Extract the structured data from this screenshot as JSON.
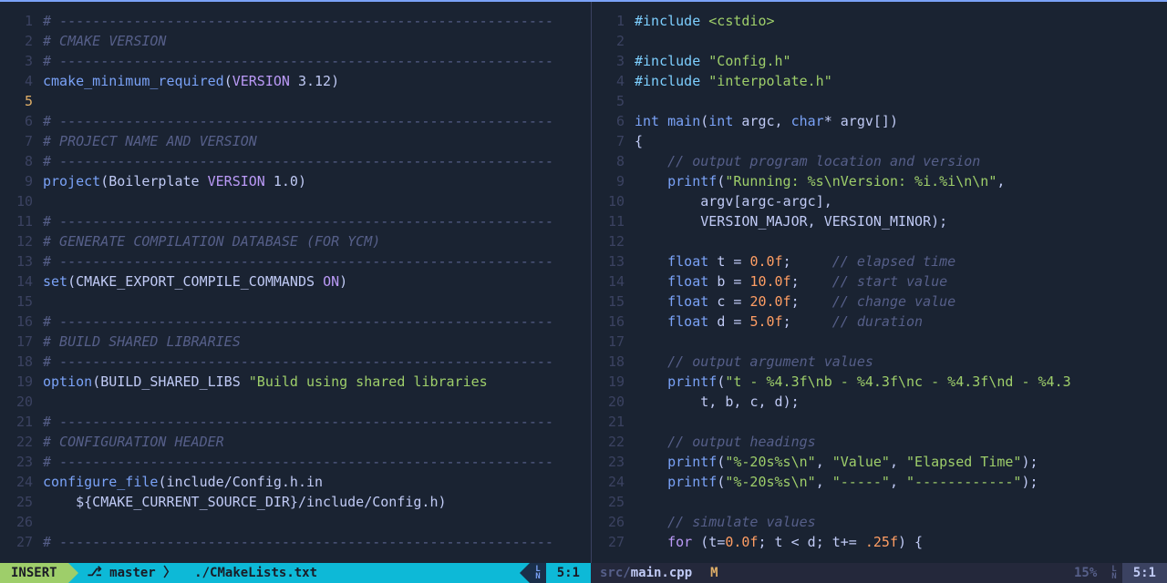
{
  "left": {
    "lines": [
      {
        "n": 1,
        "t": "comment-sep",
        "text": "# ------------------------------------------------------------"
      },
      {
        "n": 2,
        "t": "comment",
        "text": "# CMAKE VERSION"
      },
      {
        "n": 3,
        "t": "comment-sep",
        "text": "# ------------------------------------------------------------"
      },
      {
        "n": 4,
        "t": "cmake",
        "tokens": [
          [
            "func",
            "cmake_minimum_required"
          ],
          [
            "paren",
            "("
          ],
          [
            "keyword",
            "VERSION"
          ],
          [
            "id",
            " 3.12"
          ],
          [
            "paren",
            ")"
          ]
        ]
      },
      {
        "n": 5,
        "t": "blank",
        "current": true
      },
      {
        "n": 6,
        "t": "comment-sep",
        "text": "# ------------------------------------------------------------"
      },
      {
        "n": 7,
        "t": "comment",
        "text": "# PROJECT NAME AND VERSION"
      },
      {
        "n": 8,
        "t": "comment-sep",
        "text": "# ------------------------------------------------------------"
      },
      {
        "n": 9,
        "t": "cmake",
        "tokens": [
          [
            "func",
            "project"
          ],
          [
            "paren",
            "("
          ],
          [
            "id",
            "Boilerplate "
          ],
          [
            "keyword",
            "VERSION"
          ],
          [
            "id",
            " 1.0"
          ],
          [
            "paren",
            ")"
          ]
        ]
      },
      {
        "n": 10,
        "t": "blank"
      },
      {
        "n": 11,
        "t": "comment-sep",
        "text": "# ------------------------------------------------------------"
      },
      {
        "n": 12,
        "t": "comment",
        "text": "# GENERATE COMPILATION DATABASE (FOR YCM)"
      },
      {
        "n": 13,
        "t": "comment-sep",
        "text": "# ------------------------------------------------------------"
      },
      {
        "n": 14,
        "t": "cmake",
        "tokens": [
          [
            "func",
            "set"
          ],
          [
            "paren",
            "("
          ],
          [
            "id",
            "CMAKE_EXPORT_COMPILE_COMMANDS "
          ],
          [
            "keyword",
            "ON"
          ],
          [
            "paren",
            ")"
          ]
        ]
      },
      {
        "n": 15,
        "t": "blank"
      },
      {
        "n": 16,
        "t": "comment-sep",
        "text": "# ------------------------------------------------------------"
      },
      {
        "n": 17,
        "t": "comment",
        "text": "# BUILD SHARED LIBRARIES"
      },
      {
        "n": 18,
        "t": "comment-sep",
        "text": "# ------------------------------------------------------------"
      },
      {
        "n": 19,
        "t": "cmake",
        "tokens": [
          [
            "func",
            "option"
          ],
          [
            "paren",
            "("
          ],
          [
            "id",
            "BUILD_SHARED_LIBS "
          ],
          [
            "string",
            "\"Build using shared libraries"
          ]
        ]
      },
      {
        "n": 20,
        "t": "blank"
      },
      {
        "n": 21,
        "t": "comment-sep",
        "text": "# ------------------------------------------------------------"
      },
      {
        "n": 22,
        "t": "comment",
        "text": "# CONFIGURATION HEADER"
      },
      {
        "n": 23,
        "t": "comment-sep",
        "text": "# ------------------------------------------------------------"
      },
      {
        "n": 24,
        "t": "cmake",
        "tokens": [
          [
            "func",
            "configure_file"
          ],
          [
            "paren",
            "("
          ],
          [
            "id",
            "include/Config.h.in"
          ]
        ]
      },
      {
        "n": 25,
        "t": "cmake",
        "tokens": [
          [
            "id",
            "    ${CMAKE_CURRENT_SOURCE_DIR}/include/Config.h"
          ],
          [
            "paren",
            ")"
          ]
        ]
      },
      {
        "n": 26,
        "t": "blank"
      },
      {
        "n": 27,
        "t": "comment-sep",
        "text": "# ------------------------------------------------------------"
      }
    ]
  },
  "right": {
    "lines": [
      {
        "n": 1,
        "tokens": [
          [
            "include",
            "#include "
          ],
          [
            "incl-path",
            "<cstdio>"
          ]
        ]
      },
      {
        "n": 2,
        "tokens": []
      },
      {
        "n": 3,
        "tokens": [
          [
            "include",
            "#include "
          ],
          [
            "incl-path",
            "\"Config.h\""
          ]
        ]
      },
      {
        "n": 4,
        "tokens": [
          [
            "include",
            "#include "
          ],
          [
            "incl-path",
            "\"interpolate.h\""
          ]
        ]
      },
      {
        "n": 5,
        "tokens": []
      },
      {
        "n": 6,
        "tokens": [
          [
            "type",
            "int "
          ],
          [
            "func",
            "main"
          ],
          [
            "paren",
            "("
          ],
          [
            "type",
            "int "
          ],
          [
            "id",
            "argc"
          ],
          [
            "punct",
            ", "
          ],
          [
            "type",
            "char"
          ],
          [
            "punct",
            "* "
          ],
          [
            "id",
            "argv"
          ],
          [
            "paren",
            "[])"
          ]
        ]
      },
      {
        "n": 7,
        "tokens": [
          [
            "paren",
            "{"
          ]
        ]
      },
      {
        "n": 8,
        "tokens": [
          [
            "id",
            "    "
          ],
          [
            "comment",
            "// output program location and version"
          ]
        ]
      },
      {
        "n": 9,
        "tokens": [
          [
            "id",
            "    "
          ],
          [
            "func",
            "printf"
          ],
          [
            "paren",
            "("
          ],
          [
            "string",
            "\"Running: %s\\nVersion: %i.%i\\n\\n\""
          ],
          [
            "punct",
            ","
          ]
        ]
      },
      {
        "n": 10,
        "tokens": [
          [
            "id",
            "        argv"
          ],
          [
            "paren",
            "["
          ],
          [
            "id",
            "argc"
          ],
          [
            "punct",
            "-"
          ],
          [
            "id",
            "argc"
          ],
          [
            "paren",
            "]"
          ],
          [
            "punct",
            ","
          ]
        ]
      },
      {
        "n": 11,
        "tokens": [
          [
            "id",
            "        VERSION_MAJOR"
          ],
          [
            "punct",
            ", "
          ],
          [
            "id",
            "VERSION_MINOR"
          ],
          [
            "paren",
            ")"
          ],
          [
            "punct",
            ";"
          ]
        ]
      },
      {
        "n": 12,
        "tokens": []
      },
      {
        "n": 13,
        "tokens": [
          [
            "id",
            "    "
          ],
          [
            "type",
            "float "
          ],
          [
            "id",
            "t "
          ],
          [
            "punct",
            "= "
          ],
          [
            "number",
            "0.0f"
          ],
          [
            "punct",
            ";     "
          ],
          [
            "comment",
            "// elapsed time"
          ]
        ]
      },
      {
        "n": 14,
        "tokens": [
          [
            "id",
            "    "
          ],
          [
            "type",
            "float "
          ],
          [
            "id",
            "b "
          ],
          [
            "punct",
            "= "
          ],
          [
            "number",
            "10.0f"
          ],
          [
            "punct",
            ";    "
          ],
          [
            "comment",
            "// start value"
          ]
        ]
      },
      {
        "n": 15,
        "tokens": [
          [
            "id",
            "    "
          ],
          [
            "type",
            "float "
          ],
          [
            "id",
            "c "
          ],
          [
            "punct",
            "= "
          ],
          [
            "number",
            "20.0f"
          ],
          [
            "punct",
            ";    "
          ],
          [
            "comment",
            "// change value"
          ]
        ]
      },
      {
        "n": 16,
        "tokens": [
          [
            "id",
            "    "
          ],
          [
            "type",
            "float "
          ],
          [
            "id",
            "d "
          ],
          [
            "punct",
            "= "
          ],
          [
            "number",
            "5.0f"
          ],
          [
            "punct",
            ";     "
          ],
          [
            "comment",
            "// duration"
          ]
        ]
      },
      {
        "n": 17,
        "tokens": []
      },
      {
        "n": 18,
        "tokens": [
          [
            "id",
            "    "
          ],
          [
            "comment",
            "// output argument values"
          ]
        ]
      },
      {
        "n": 19,
        "tokens": [
          [
            "id",
            "    "
          ],
          [
            "func",
            "printf"
          ],
          [
            "paren",
            "("
          ],
          [
            "string",
            "\"t - %4.3f\\nb - %4.3f\\nc - %4.3f\\nd - %4.3"
          ]
        ]
      },
      {
        "n": 20,
        "tokens": [
          [
            "id",
            "        t"
          ],
          [
            "punct",
            ", "
          ],
          [
            "id",
            "b"
          ],
          [
            "punct",
            ", "
          ],
          [
            "id",
            "c"
          ],
          [
            "punct",
            ", "
          ],
          [
            "id",
            "d"
          ],
          [
            "paren",
            ")"
          ],
          [
            "punct",
            ";"
          ]
        ]
      },
      {
        "n": 21,
        "tokens": []
      },
      {
        "n": 22,
        "tokens": [
          [
            "id",
            "    "
          ],
          [
            "comment",
            "// output headings"
          ]
        ]
      },
      {
        "n": 23,
        "tokens": [
          [
            "id",
            "    "
          ],
          [
            "func",
            "printf"
          ],
          [
            "paren",
            "("
          ],
          [
            "string",
            "\"%-20s%s\\n\""
          ],
          [
            "punct",
            ", "
          ],
          [
            "string",
            "\"Value\""
          ],
          [
            "punct",
            ", "
          ],
          [
            "string",
            "\"Elapsed Time\""
          ],
          [
            "paren",
            ")"
          ],
          [
            "punct",
            ";"
          ]
        ]
      },
      {
        "n": 24,
        "tokens": [
          [
            "id",
            "    "
          ],
          [
            "func",
            "printf"
          ],
          [
            "paren",
            "("
          ],
          [
            "string",
            "\"%-20s%s\\n\""
          ],
          [
            "punct",
            ", "
          ],
          [
            "string",
            "\"-----\""
          ],
          [
            "punct",
            ", "
          ],
          [
            "string",
            "\"------------\""
          ],
          [
            "paren",
            ")"
          ],
          [
            "punct",
            ";"
          ]
        ]
      },
      {
        "n": 25,
        "tokens": []
      },
      {
        "n": 26,
        "tokens": [
          [
            "id",
            "    "
          ],
          [
            "comment",
            "// simulate values"
          ]
        ]
      },
      {
        "n": 27,
        "tokens": [
          [
            "id",
            "    "
          ],
          [
            "keyword",
            "for "
          ],
          [
            "paren",
            "("
          ],
          [
            "id",
            "t"
          ],
          [
            "punct",
            "="
          ],
          [
            "number",
            "0.0f"
          ],
          [
            "punct",
            "; "
          ],
          [
            "id",
            "t "
          ],
          [
            "punct",
            "< "
          ],
          [
            "id",
            "d"
          ],
          [
            "punct",
            "; "
          ],
          [
            "id",
            "t"
          ],
          [
            "punct",
            "+= "
          ],
          [
            "number",
            ".25f"
          ],
          [
            "paren",
            ") {"
          ]
        ]
      }
    ]
  },
  "status_left": {
    "mode": "INSERT",
    "branch": "master",
    "file": "./CMakeLists.txt",
    "pos": "5:1"
  },
  "status_right": {
    "file_dir": "src/",
    "file_name": "main.cpp",
    "modified": "M",
    "percent": "15%",
    "pos": "5:1"
  }
}
